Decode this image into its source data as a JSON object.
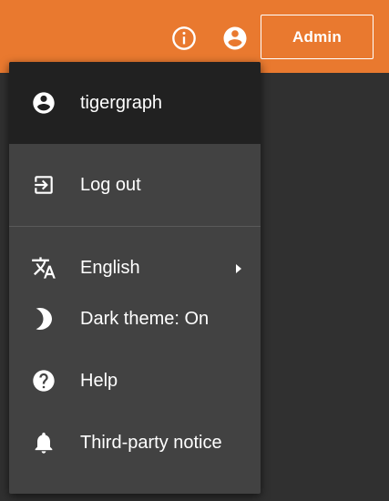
{
  "header": {
    "background_color": "#e9792f",
    "info_icon": "info-icon",
    "account_icon": "account-circle-icon",
    "admin_label": "Admin"
  },
  "menu": {
    "user": {
      "icon": "account-circle-icon",
      "name": "tigergraph"
    },
    "logout": {
      "icon": "logout-icon",
      "label": "Log out"
    },
    "language": {
      "icon": "translate-icon",
      "label": "English",
      "submenu_icon": "chevron-right-icon"
    },
    "theme": {
      "icon": "moon-icon",
      "label": "Dark theme: On"
    },
    "help": {
      "icon": "help-circle-icon",
      "label": "Help"
    },
    "notice": {
      "icon": "bell-icon",
      "label": "Third-party notice"
    }
  }
}
